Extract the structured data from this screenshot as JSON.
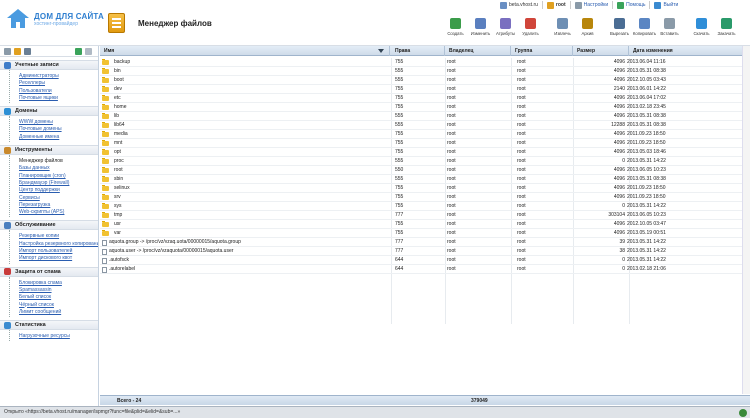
{
  "logo": {
    "title": "ДОМ ДЛЯ САЙТА",
    "subtitle": "хостинг-провайдер"
  },
  "page": {
    "title": "Менеджер файлов"
  },
  "topbar": {
    "host": "beta.vhost.ru",
    "user": "root",
    "settings": "Настройки",
    "help": "Помощь",
    "logout": "Выйти"
  },
  "toolbar": [
    {
      "label": "Создать",
      "icon": "create-folder-icon",
      "color": "#3b9c4a"
    },
    {
      "label": "Изменить",
      "icon": "edit-icon",
      "color": "#5a7fbf"
    },
    {
      "label": "Атрибуты",
      "icon": "attributes-icon",
      "color": "#7a6fc0"
    },
    {
      "label": "Удалить",
      "icon": "delete-icon",
      "color": "#d0453a"
    },
    {
      "label": "Извлечь",
      "icon": "extract-icon",
      "color": "#6e8fb4"
    },
    {
      "label": "Архив",
      "icon": "archive-icon",
      "color": "#b8860b"
    },
    {
      "label": "Вырезать",
      "icon": "cut-icon",
      "color": "#4b6d94"
    },
    {
      "label": "Копировать",
      "icon": "copy-icon",
      "color": "#5b86c3"
    },
    {
      "label": "Вставить",
      "icon": "paste-icon",
      "color": "#8a9aa8"
    },
    {
      "label": "Скачать",
      "icon": "download-icon",
      "color": "#2f8ed8"
    },
    {
      "label": "Закачать",
      "icon": "upload-icon",
      "color": "#2a9a6a"
    }
  ],
  "sidebar": [
    {
      "title": "Учетные записи",
      "icon": "accounts-icon",
      "color": "#3f7dc9",
      "items": [
        "Администраторы",
        "Реселлеры",
        "Пользователи",
        "Почтовые ящики"
      ]
    },
    {
      "title": "Домены",
      "icon": "domains-icon",
      "color": "#2d8fd5",
      "items": [
        "WWW домены",
        "Почтовые домены",
        "Доменные имена"
      ]
    },
    {
      "title": "Инструменты",
      "icon": "tools-icon",
      "color": "#c9892c",
      "items": [
        "Менеджер файлов",
        "Базы данных",
        "Планировщик (cron)",
        "Брандмауэр (Firewall)",
        "Центр поддержки",
        "Сервисы",
        "Перезагрузка",
        "Web-скрипты (APS)"
      ]
    },
    {
      "title": "Обслуживание",
      "icon": "maintenance-icon",
      "color": "#4a7fbf",
      "items": [
        "Резервные копии",
        "Настройка резервного копирования",
        "Импорт пользователей",
        "Импорт дискового квот"
      ]
    },
    {
      "title": "Защита от спама",
      "icon": "antispam-icon",
      "color": "#c83b3b",
      "items": [
        "Блокировка спама",
        "Spamassassin",
        "Белый список",
        "Чёрный список",
        "Лимит сообщений"
      ]
    },
    {
      "title": "Статистика",
      "icon": "statistics-icon",
      "color": "#3b8bd0",
      "items": [
        "Нагрузочные ресурсы"
      ]
    }
  ],
  "table": {
    "headers": {
      "name": "Имя",
      "perm": "Права",
      "owner": "Владелец",
      "group": "Группа",
      "size": "Размер",
      "date": "Дата изменения"
    },
    "rows": [
      {
        "type": "dir",
        "name": "backup",
        "perm": "755",
        "owner": "root",
        "group": "root",
        "size": "4096",
        "date": "2013.06.04 11:16"
      },
      {
        "type": "dir",
        "name": "bin",
        "perm": "555",
        "owner": "root",
        "group": "root",
        "size": "4096",
        "date": "2013.05.31 08:38"
      },
      {
        "type": "dir",
        "name": "boot",
        "perm": "555",
        "owner": "root",
        "group": "root",
        "size": "4096",
        "date": "2012.10.05 03:43"
      },
      {
        "type": "dir",
        "name": "dev",
        "perm": "755",
        "owner": "root",
        "group": "root",
        "size": "2140",
        "date": "2013.06.01 14:22"
      },
      {
        "type": "dir",
        "name": "etc",
        "perm": "755",
        "owner": "root",
        "group": "root",
        "size": "4096",
        "date": "2013.06.04 17:02"
      },
      {
        "type": "dir",
        "name": "home",
        "perm": "755",
        "owner": "root",
        "group": "root",
        "size": "4096",
        "date": "2013.02.18 23:45"
      },
      {
        "type": "dir",
        "name": "lib",
        "perm": "555",
        "owner": "root",
        "group": "root",
        "size": "4096",
        "date": "2013.05.31 08:38"
      },
      {
        "type": "dir",
        "name": "lib64",
        "perm": "555",
        "owner": "root",
        "group": "root",
        "size": "12288",
        "date": "2013.05.31 08:38"
      },
      {
        "type": "dir",
        "name": "media",
        "perm": "755",
        "owner": "root",
        "group": "root",
        "size": "4096",
        "date": "2011.09.23 18:50"
      },
      {
        "type": "dir",
        "name": "mnt",
        "perm": "755",
        "owner": "root",
        "group": "root",
        "size": "4096",
        "date": "2011.09.23 18:50"
      },
      {
        "type": "dir",
        "name": "opt",
        "perm": "755",
        "owner": "root",
        "group": "root",
        "size": "4096",
        "date": "2013.05.03 18:46"
      },
      {
        "type": "dir",
        "name": "proc",
        "perm": "555",
        "owner": "root",
        "group": "root",
        "size": "0",
        "date": "2013.05.31 14:22"
      },
      {
        "type": "dir",
        "name": "root",
        "perm": "550",
        "owner": "root",
        "group": "root",
        "size": "4096",
        "date": "2013.06.05 10:23"
      },
      {
        "type": "dir",
        "name": "sbin",
        "perm": "555",
        "owner": "root",
        "group": "root",
        "size": "4096",
        "date": "2013.05.31 08:38"
      },
      {
        "type": "dir",
        "name": "selinux",
        "perm": "755",
        "owner": "root",
        "group": "root",
        "size": "4096",
        "date": "2011.09.23 18:50"
      },
      {
        "type": "dir",
        "name": "srv",
        "perm": "755",
        "owner": "root",
        "group": "root",
        "size": "4096",
        "date": "2011.09.23 18:50"
      },
      {
        "type": "dir",
        "name": "sys",
        "perm": "755",
        "owner": "root",
        "group": "root",
        "size": "0",
        "date": "2013.05.31 14:22"
      },
      {
        "type": "dir",
        "name": "tmp",
        "perm": "777",
        "owner": "root",
        "group": "root",
        "size": "303104",
        "date": "2013.06.05 10:23"
      },
      {
        "type": "dir",
        "name": "usr",
        "perm": "755",
        "owner": "root",
        "group": "root",
        "size": "4096",
        "date": "2012.10.05 03:47"
      },
      {
        "type": "dir",
        "name": "var",
        "perm": "755",
        "owner": "root",
        "group": "root",
        "size": "4096",
        "date": "2013.05.19 00:51"
      },
      {
        "type": "link",
        "name": "aquota.group -> /proc/vz/vzaq.uota/00000015/aquota.group",
        "perm": "777",
        "owner": "root",
        "group": "root",
        "size": "39",
        "date": "2013.05.31 14:22"
      },
      {
        "type": "link",
        "name": "aquota.user -> /proc/vz/vzaquota/00000015/aquota.user",
        "perm": "777",
        "owner": "root",
        "group": "root",
        "size": "38",
        "date": "2013.05.31 14:22"
      },
      {
        "type": "file",
        "name": ".autofsck",
        "perm": "644",
        "owner": "root",
        "group": "root",
        "size": "0",
        "date": "2013.05.31 14:22"
      },
      {
        "type": "file",
        "name": ".autorelabel",
        "perm": "644",
        "owner": "root",
        "group": "root",
        "size": "0",
        "date": "2013.02.18 21:06"
      }
    ],
    "footer": {
      "total": "Всего - 24",
      "size_total": "379049"
    }
  },
  "status": {
    "url": "Открыто «https://beta.vhost.ru/manager/ispmgr?func=file&plid=&elid=&sub=...»"
  }
}
